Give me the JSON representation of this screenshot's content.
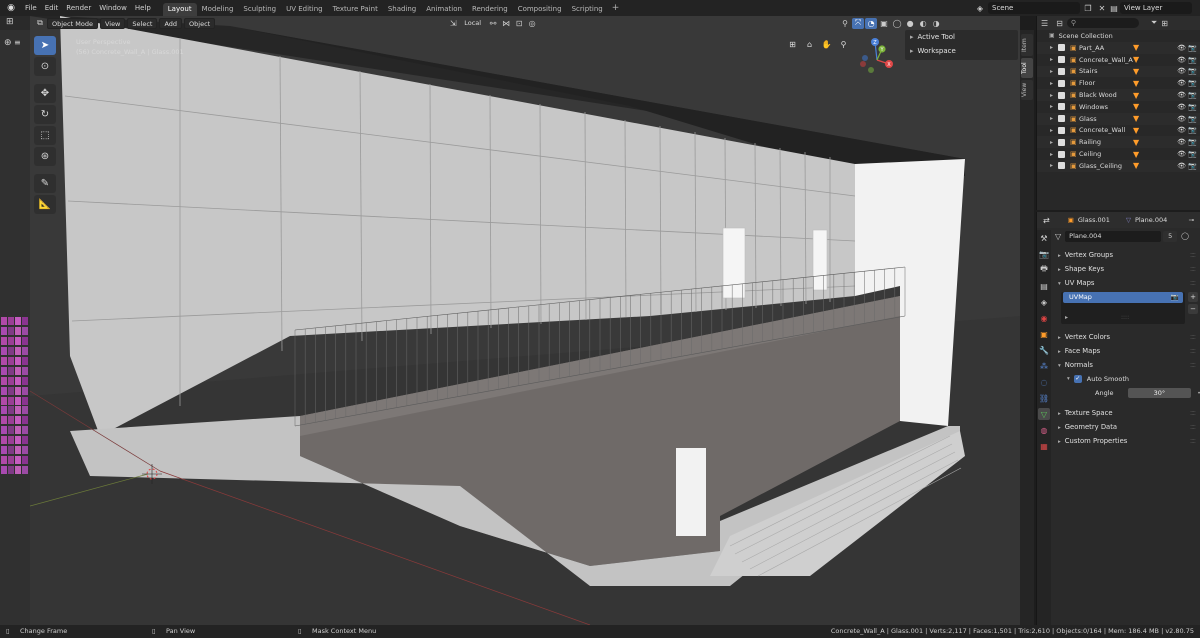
{
  "topbar": {
    "menus": [
      "File",
      "Edit",
      "Render",
      "Window",
      "Help"
    ],
    "workspaces": [
      "Layout",
      "Modeling",
      "Sculpting",
      "UV Editing",
      "Texture Paint",
      "Shading",
      "Animation",
      "Rendering",
      "Compositing",
      "Scripting"
    ],
    "active_workspace": "Layout",
    "add_workspace": "+",
    "scene": "Scene",
    "view_layer": "View Layer"
  },
  "viewport": {
    "mode": "Object Mode",
    "menus": [
      "View",
      "Select",
      "Add",
      "Object"
    ],
    "transform_orientation": "Local",
    "perspective_label": "User Perspective",
    "object_label": "(56) Concrete_Wall_A | Glass.001",
    "gizmo": {
      "x": "X",
      "y": "Y",
      "z": "Z"
    }
  },
  "npanel": {
    "rows": [
      "Active Tool",
      "Workspace"
    ],
    "tabs": [
      "Item",
      "Tool",
      "View"
    ],
    "active_tab": "Tool"
  },
  "outliner": {
    "search_placeholder": "",
    "collection": "Scene Collection",
    "items": [
      "Part_AA",
      "Concrete_Wall_A",
      "Stairs",
      "Floor",
      "Black Wood",
      "Windows",
      "Glass",
      "Concrete_Wall",
      "Railing",
      "Ceiling",
      "Glass_Ceiling"
    ]
  },
  "properties": {
    "header_object": "Glass.001",
    "header_mesh": "Plane.004",
    "mesh_name": "Plane.004",
    "mesh_users": "5",
    "sections_top": [
      "Vertex Groups",
      "Shape Keys",
      "UV Maps"
    ],
    "uv_map": "UVMap",
    "sections_mid": [
      "Vertex Colors",
      "Face Maps",
      "Normals"
    ],
    "auto_smooth_label": "Auto Smooth",
    "angle_label": "Angle",
    "angle_value": "30°",
    "sections_bottom": [
      "Texture Space",
      "Geometry Data",
      "Custom Properties"
    ]
  },
  "statusbar": {
    "left1": "Change Frame",
    "left2": "Pan View",
    "left3": "Mask Context Menu",
    "stats": "Concrete_Wall_A | Glass.001 | Verts:2,117 | Faces:1,501 | Tris:2,610 | Objects:0/164 | Mem: 186.4 MB | v2.80.75"
  },
  "colors": {
    "accent": "#4772b3",
    "object_orange": "#ff9c2a",
    "viewport_bg": "#393939"
  }
}
